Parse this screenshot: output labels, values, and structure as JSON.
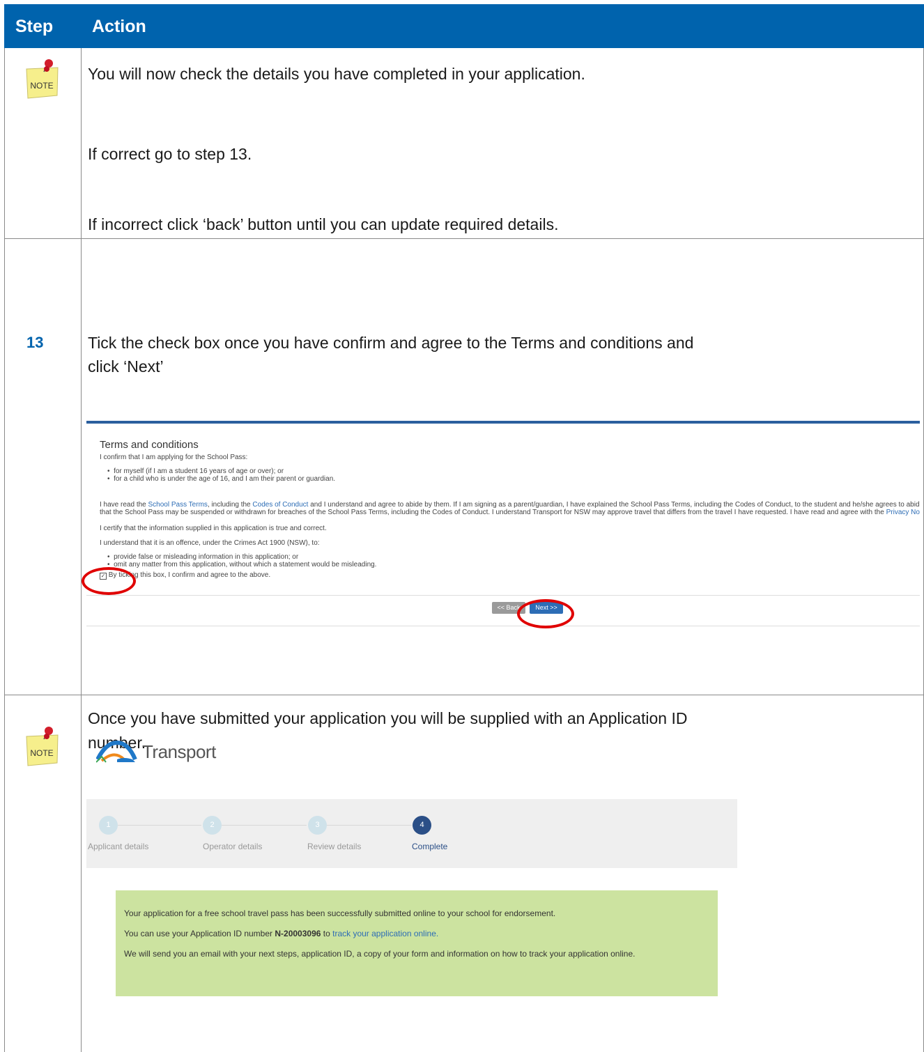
{
  "header": {
    "step": "Step",
    "action": "Action"
  },
  "note_label": "NOTE",
  "row1": {
    "line1": "You will now check the details you have completed in your application.",
    "line2": "If correct go to step 13.",
    "line3": "If incorrect click ‘back’ button until you can update required details."
  },
  "row2": {
    "step_number": "13",
    "line1": "Tick the check box once you have confirm and agree to the Terms and conditions and",
    "line2": "click ‘Next’"
  },
  "terms": {
    "title": "Terms and conditions",
    "confirm": "I confirm that I am applying for the School Pass:",
    "bullet1": "for myself (if I am a student 16 years of age or over); or",
    "bullet2": "for a child who is under the age of 16, and I am their parent or guardian.",
    "p1a": "I have read the ",
    "p1_link1": "School Pass Terms",
    "p1b": ", including the ",
    "p1_link2": "Codes of Conduct",
    "p1c": " and I understand and agree to abide by them. If I am signing as a parent/guardian, I have explained the School Pass Terms, including the Codes of Conduct, to the student and he/she agrees to abide by them. I und",
    "p1d": "that the School Pass may be suspended or withdrawn for breaches of the School Pass Terms, including the Codes of Conduct. I understand Transport for NSW may approve travel that differs from the travel I have requested. I have read and agree with the ",
    "p1_link3": "Privacy Notice",
    "certify": "I certify that the information supplied in this application is true and correct.",
    "offence": "I understand that it is an offence, under the Crimes Act 1900 (NSW), to:",
    "bullet3": "provide false or misleading information in this application; or",
    "bullet4": "omit any matter from this application, without which a statement would be misleading.",
    "checkbox_label": "By ticking this box, I confirm and agree to the above.",
    "back_button": "<< Back",
    "next_button": "Next >>"
  },
  "row3": {
    "line1": "Once you have submitted your application you will be supplied with an Application ID",
    "line2": "number."
  },
  "complete": {
    "logo_text": "Transport",
    "steps": [
      {
        "num": "1",
        "label": "Applicant details"
      },
      {
        "num": "2",
        "label": "Operator details"
      },
      {
        "num": "3",
        "label": "Review details"
      },
      {
        "num": "4",
        "label": "Complete"
      }
    ],
    "msg1": "Your application for a free school travel pass has been successfully submitted online to your school for endorsement.",
    "msg2a": "You can use your Application ID number ",
    "app_id": "N-20003096",
    "msg2b": " to ",
    "msg2_link": "track your application online.",
    "msg3": "We will send you an email with your next steps, application ID, a copy of your form and information on how to track your application online."
  },
  "colors": {
    "header_blue": "#0063ad",
    "success_green": "#cce3a0",
    "highlight_red": "#e00000"
  }
}
